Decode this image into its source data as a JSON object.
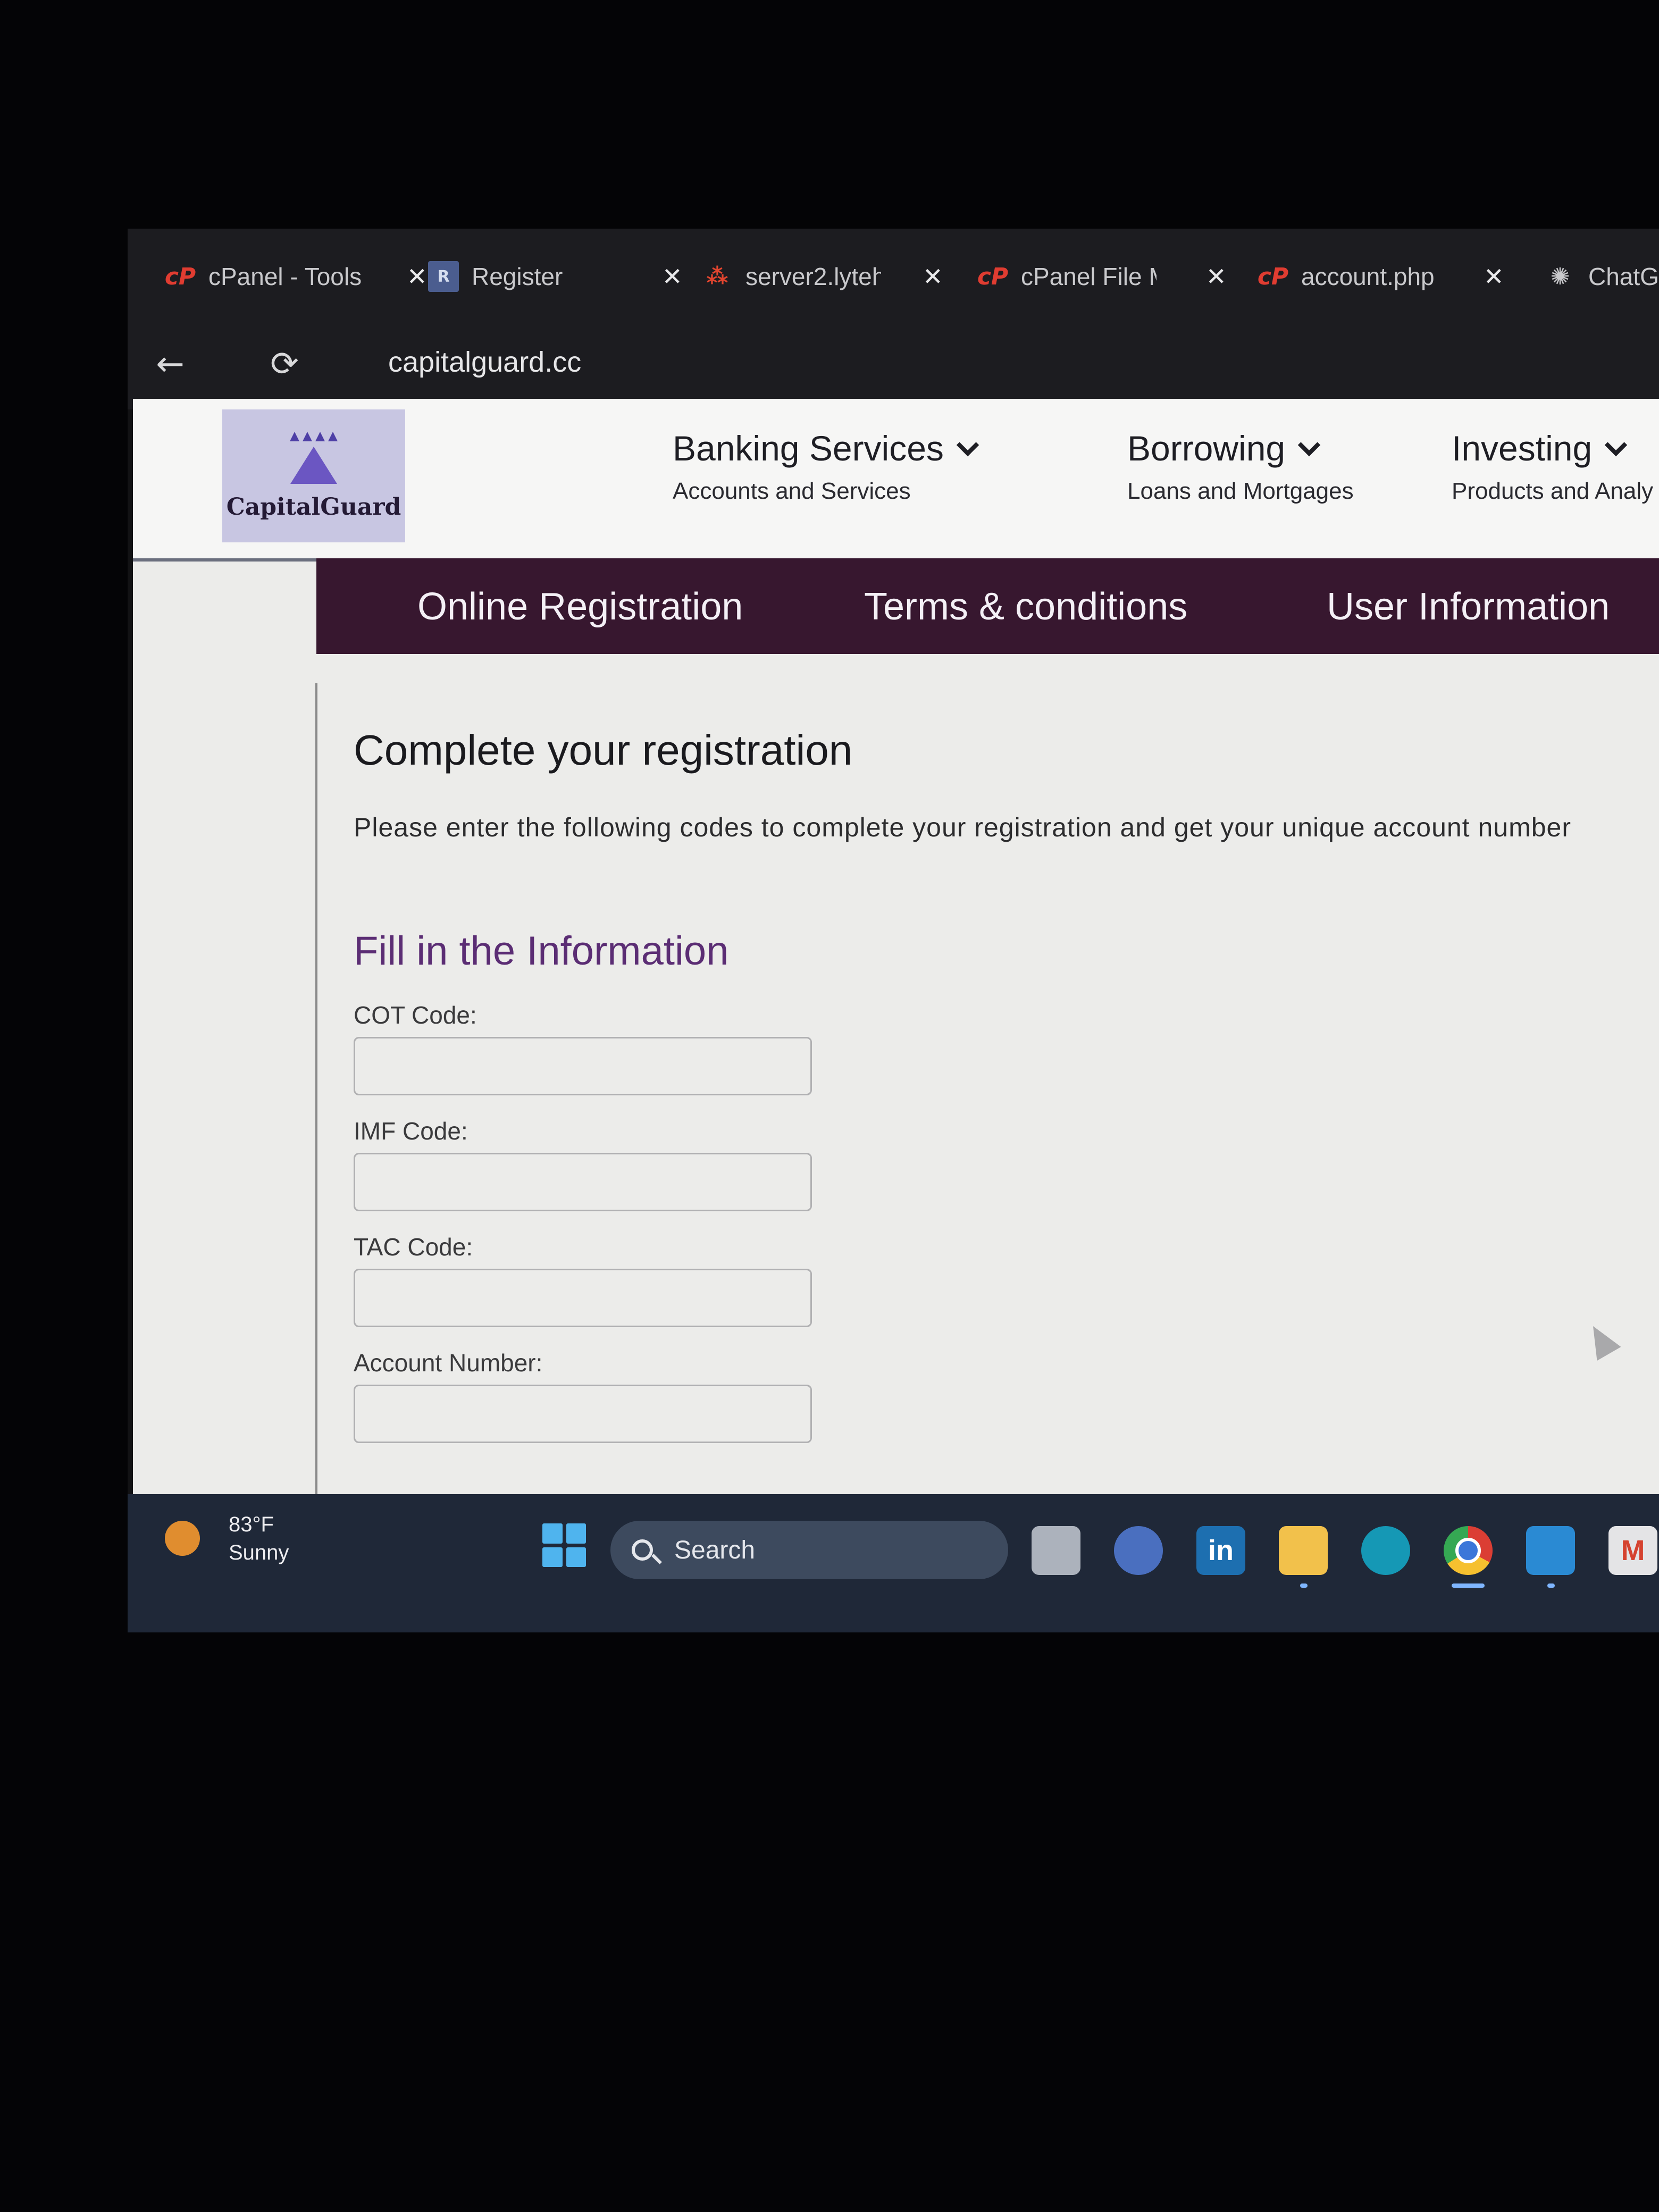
{
  "browser": {
    "tabs": [
      {
        "icon": "cpanel-icon",
        "label": "cPanel - Tools"
      },
      {
        "icon": "register-page-icon",
        "label": "Register"
      },
      {
        "icon": "server-icon",
        "label": "server2.lyteh"
      },
      {
        "icon": "cpanel-icon",
        "label": "cPanel File M"
      },
      {
        "icon": "cpanel-icon",
        "label": "account.php"
      },
      {
        "icon": "chatgpt-icon",
        "label": "ChatG"
      }
    ],
    "close_glyph": "✕",
    "back_glyph": "←",
    "reload_glyph": "⟳",
    "url": "capitalguard.cc"
  },
  "site": {
    "logo_text": "CapitalGuard",
    "nav": [
      {
        "title": "Banking Services",
        "subtitle": "Accounts and Services"
      },
      {
        "title": "Borrowing",
        "subtitle": "Loans and Mortgages"
      },
      {
        "title": "Investing",
        "subtitle": "Products and Analy"
      }
    ],
    "subnav": [
      "Online Registration",
      "Terms & conditions",
      "User Information"
    ],
    "accent_colors": {
      "subnav_bg": "#37172f",
      "section_heading": "#5b2d74"
    }
  },
  "form": {
    "heading": "Complete your registration",
    "intro": "Please enter the following codes to complete your registration and get your unique account number",
    "section_title": "Fill in the Information",
    "fields": [
      {
        "label": "COT Code:",
        "value": ""
      },
      {
        "label": "IMF Code:",
        "value": ""
      },
      {
        "label": "TAC Code:",
        "value": ""
      },
      {
        "label": "Account Number:",
        "value": ""
      }
    ]
  },
  "taskbar": {
    "weather_temp": "83°F",
    "weather_desc": "Sunny",
    "search_placeholder": "Search",
    "apps": [
      "task-view-icon",
      "meet-icon",
      "linkedin-icon",
      "file-explorer-icon",
      "edge-icon",
      "chrome-icon",
      "vscode-icon",
      "gmail-icon"
    ],
    "linkedin_text": "in",
    "gmail_text": "M"
  }
}
